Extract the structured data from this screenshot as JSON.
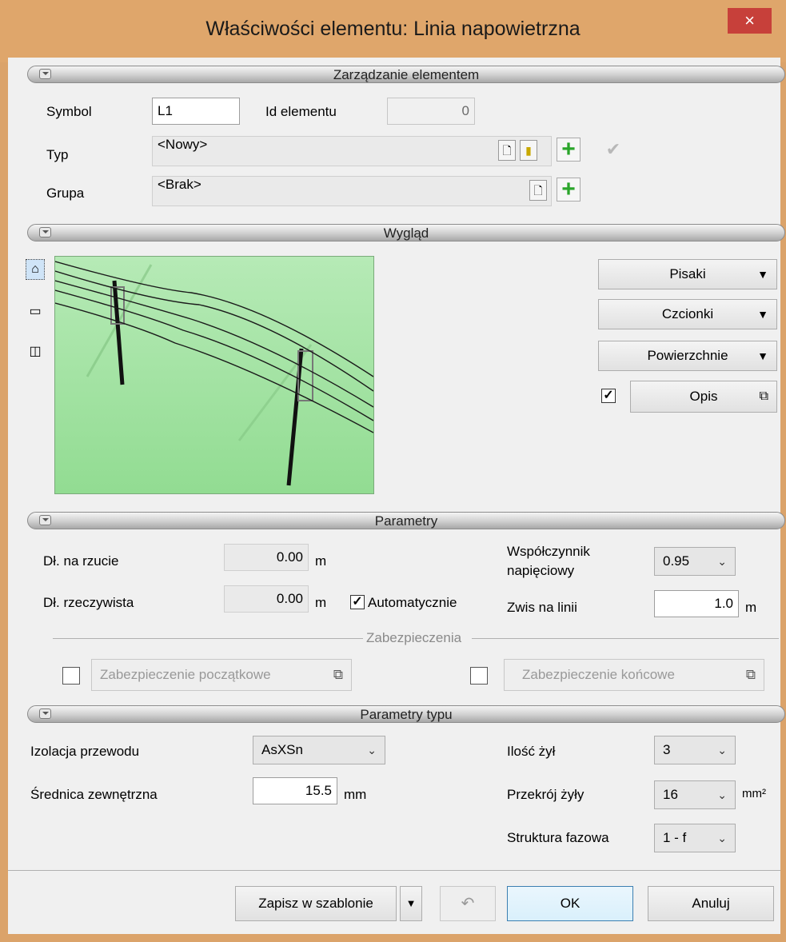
{
  "window": {
    "title": "Właściwości elementu: Linia napowietrzna",
    "close_label": "×"
  },
  "sections": {
    "management": "Zarządzanie elementem",
    "appearance": "Wygląd",
    "params": "Parametry",
    "type_params": "Parametry typu"
  },
  "management": {
    "symbol_label": "Symbol",
    "symbol_value": "L1",
    "id_label": "Id elementu",
    "id_value": "0",
    "type_label": "Typ",
    "type_value": "<Nowy>",
    "group_label": "Grupa",
    "group_value": "<Brak>"
  },
  "appearance": {
    "pens": "Pisaki",
    "fonts": "Czcionki",
    "surfaces": "Powierzchnie",
    "description": "Opis",
    "description_checked": true
  },
  "params": {
    "proj_length_label": "Dł. na rzucie",
    "proj_length_value": "0.00",
    "proj_length_unit": "m",
    "real_length_label": "Dł. rzeczywista",
    "real_length_value": "0.00",
    "real_length_unit": "m",
    "auto_label": "Automatycznie",
    "auto_checked": true,
    "voltage_factor_label_1": "Współczynnik",
    "voltage_factor_label_2": "napięciowy",
    "voltage_factor_value": "0.95",
    "sag_label": "Zwis na linii",
    "sag_value": "1.0",
    "sag_unit": "m",
    "protection_heading": "Zabezpieczenia",
    "start_protection": "Zabezpieczenie początkowe",
    "end_protection": "Zabezpieczenie końcowe"
  },
  "type_params": {
    "insulation_label": "Izolacja przewodu",
    "insulation_value": "AsXSn",
    "diameter_label": "Średnica zewnętrzna",
    "diameter_value": "15.5",
    "diameter_unit": "mm",
    "cores_label": "Ilość żył",
    "cores_value": "3",
    "cross_section_label": "Przekrój żyły",
    "cross_section_value": "16",
    "cross_section_unit": "mm²",
    "phase_label": "Struktura fazowa",
    "phase_value": "1 - f"
  },
  "footer": {
    "save_template": "Zapisz w szablonie",
    "ok": "OK",
    "cancel": "Anuluj"
  }
}
